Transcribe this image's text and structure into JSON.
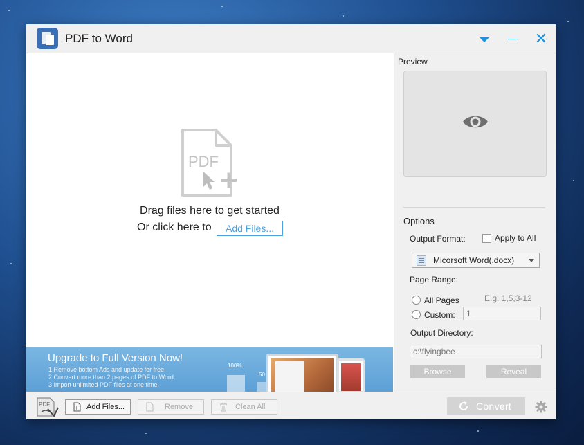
{
  "window": {
    "title": "PDF to Word"
  },
  "droparea": {
    "drag_text": "Drag files here to get started",
    "or_text": "Or click here to",
    "add_files_link": "Add Files...",
    "icon_text": "PDF"
  },
  "banner": {
    "title": "Upgrade to Full Version Now!",
    "lines": [
      "1 Remove bottom Ads and update for free.",
      "2 Convert more than 2 pages of PDF to Word.",
      "3 Import unlimited PDF files at one time."
    ],
    "pct_a": "100%",
    "pct_b": "50"
  },
  "toolbar": {
    "logo_text": "PDF",
    "add_files": "Add Files...",
    "remove": "Remove",
    "clean_all": "Clean All",
    "convert": "Convert"
  },
  "panel": {
    "preview_label": "Preview",
    "options_label": "Options",
    "output_format_label": "Output Format:",
    "apply_to_all": "Apply to All",
    "format_selected": "Micorsoft Word(.docx)",
    "page_range_label": "Page Range:",
    "all_pages": "All Pages",
    "custom": "Custom:",
    "range_hint": "E.g. 1,5,3-12",
    "custom_value": "1",
    "output_dir_label": "Output Directory:",
    "output_dir_value": "c:\\flyingbee",
    "browse": "Browse",
    "reveal": "Reveal"
  },
  "colors": {
    "accent": "#1e90dc",
    "banner": "#6aaadc",
    "panel_bg": "#f0f0f0"
  }
}
